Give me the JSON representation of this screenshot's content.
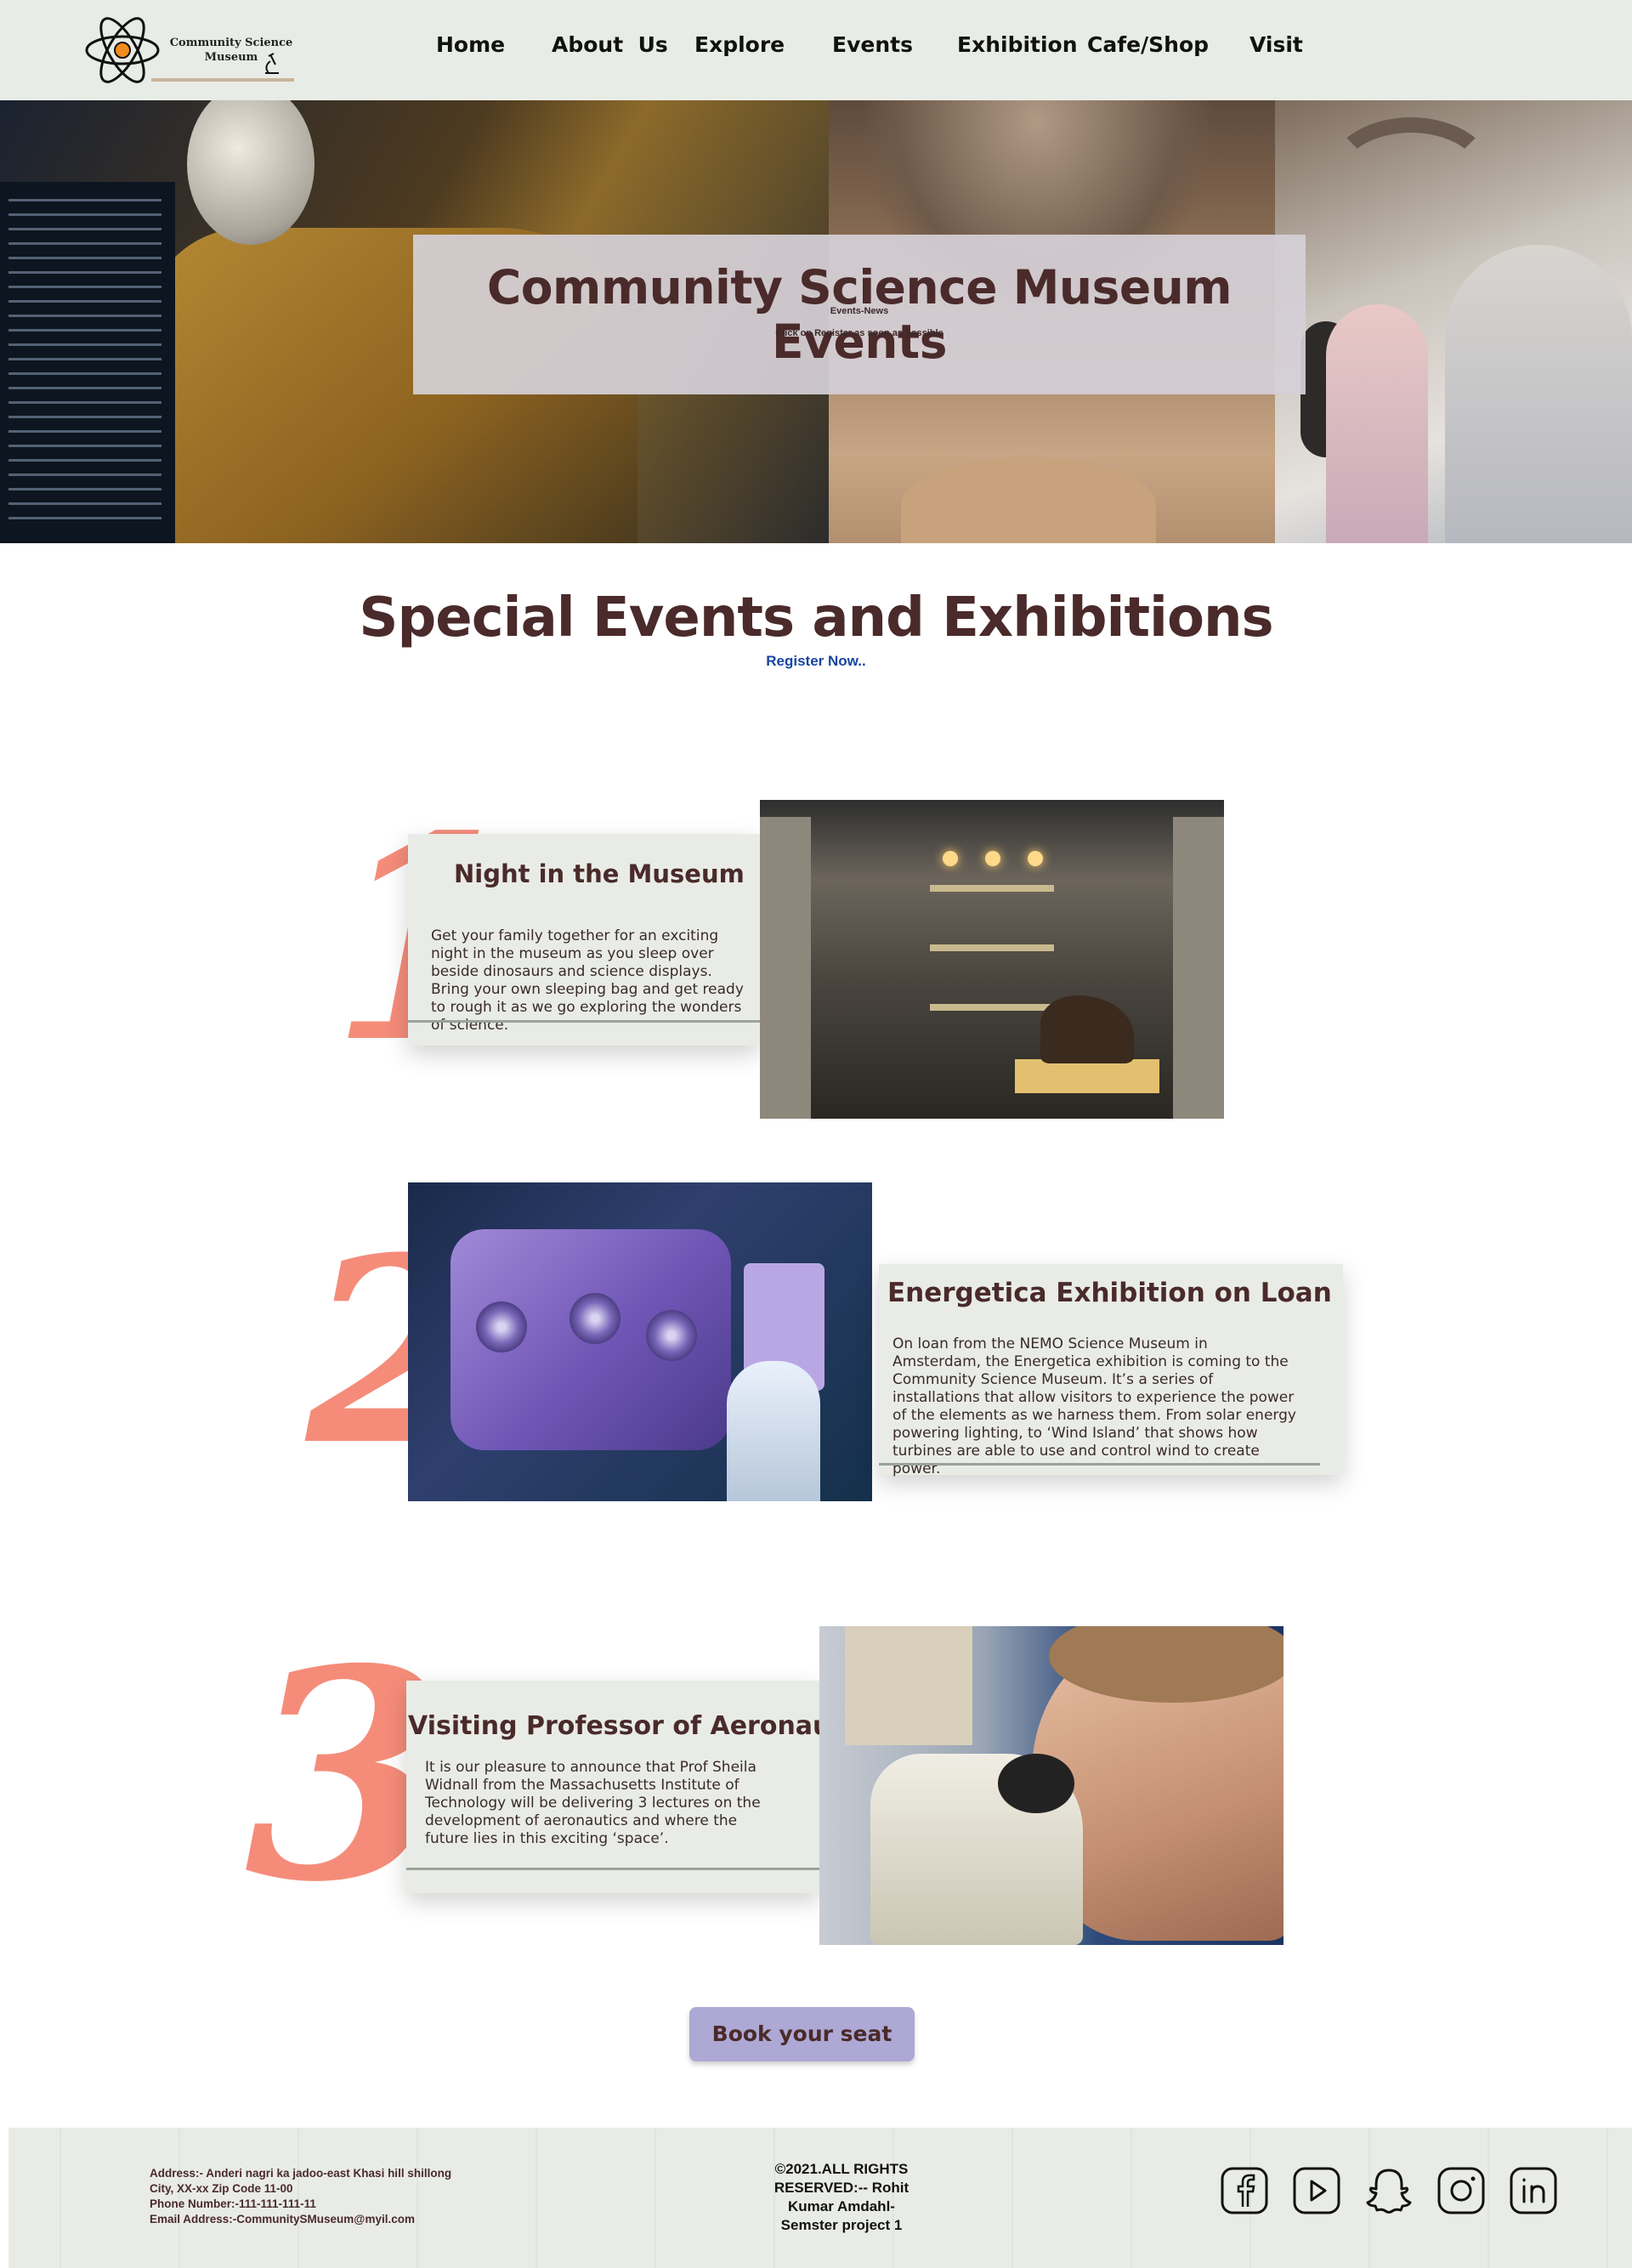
{
  "header": {
    "logo_line1": "Community Science",
    "logo_line2": "Museum",
    "nav": [
      "Home",
      "About  Us",
      "Explore",
      "Events",
      "Exhibition",
      "Cafe/Shop",
      "Visit"
    ]
  },
  "hero": {
    "title": "Community Science Museum Events",
    "subtitle": "Events-News",
    "note": "Click on Register as soon as possible"
  },
  "section": {
    "title": "Special Events and Exhibitions",
    "register_link": "Register Now.."
  },
  "events": [
    {
      "number": "1",
      "title": "Night in the Museum",
      "body": "Get your family together for an exciting night in the museum as you sleep over beside dinosaurs and science displays. Bring your own sleeping bag and get ready to rough it as we go exploring the wonders of science."
    },
    {
      "number": "2",
      "title": "Energetica Exhibition on Loan",
      "body": "On loan from the NEMO Science Museum in Amsterdam, the Energetica exhibition is coming to the Community Science Museum. It’s a series of installations that allow visitors to experience the power of the elements as we harness them. From solar energy powering lighting, to ‘Wind Island’ that shows how turbines are able to use and control wind to create power."
    },
    {
      "number": "3",
      "title": "Visiting Professor of Aeronautics",
      "body": "It is our pleasure to announce that Prof Sheila Widnall from the Massachusetts Institute of Technology will be delivering 3 lectures on the development of aeronautics and where the future lies in this exciting ‘space’."
    }
  ],
  "book_button": "Book your seat",
  "footer": {
    "address": [
      "Address:- Anderi nagri ka jadoo-east Khasi hill shillong",
      "City, XX-xx Zip Code 11-00",
      "Phone Number:-111-111-111-11",
      "Email Address:-CommunitySMuseum@myil.com"
    ],
    "copyright": [
      "©2021.ALL RIGHTS",
      "RESERVED:-- Rohit",
      "Kumar Amdahl-",
      "Semster project 1"
    ],
    "social_icons": [
      "facebook-icon",
      "youtube-icon",
      "snapchat-icon",
      "instagram-icon",
      "linkedin-icon"
    ]
  },
  "colors": {
    "header_bg": "#e8ece6",
    "heading_text": "#4a2a2a",
    "accent_number": "#f58c7a",
    "link": "#1746a2",
    "button_bg": "#ada8d4",
    "card_bg": "#e9ece6"
  }
}
